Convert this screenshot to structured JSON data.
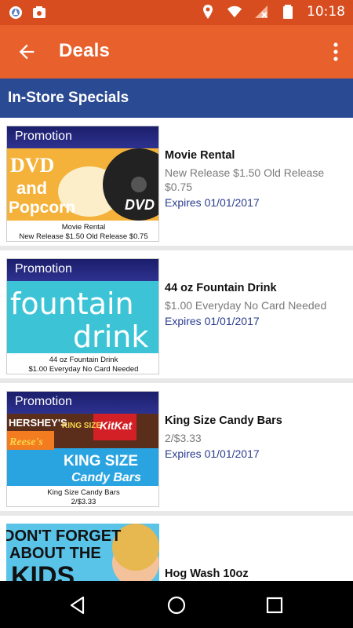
{
  "status": {
    "time": "10:18"
  },
  "appbar": {
    "title": "Deals"
  },
  "section": {
    "title": "In-Store Specials"
  },
  "promo_label": "Promotion",
  "deals": [
    {
      "art_line1": "DVD",
      "art_line2": "and",
      "art_line3": "Popcorn",
      "art_badge": "DVD",
      "caption_line1": "Movie Rental",
      "caption_line2": "New Release $1.50 Old Release $0.75",
      "name": "Movie Rental",
      "desc": "New Release $1.50 Old Release $0.75",
      "expires": "Expires 01/01/2017"
    },
    {
      "art_line1": "fountain",
      "art_line2": "drink",
      "caption_line1": "44 oz Fountain Drink",
      "caption_line2": "$1.00 Everyday No Card Needed",
      "name": "44 oz Fountain Drink",
      "desc": "$1.00 Everyday No Card Needed",
      "expires": "Expires 01/01/2017"
    },
    {
      "art_line1": "KING SIZE",
      "art_line2": "Candy Bars",
      "bar1": "HERSHEY'S",
      "bar2": "KING SIZE",
      "bar3": "KitKat",
      "bar4": "Reese's",
      "caption_line1": "King Size Candy Bars",
      "caption_line2": "2/$3.33",
      "name": "King Size Candy Bars",
      "desc": "2/$3.33",
      "expires": "Expires 01/01/2017"
    },
    {
      "art_line1": "DON'T FORGET",
      "art_line2": "ABOUT THE",
      "art_line3": "KIDS",
      "name": "Hog Wash 10oz"
    }
  ]
}
